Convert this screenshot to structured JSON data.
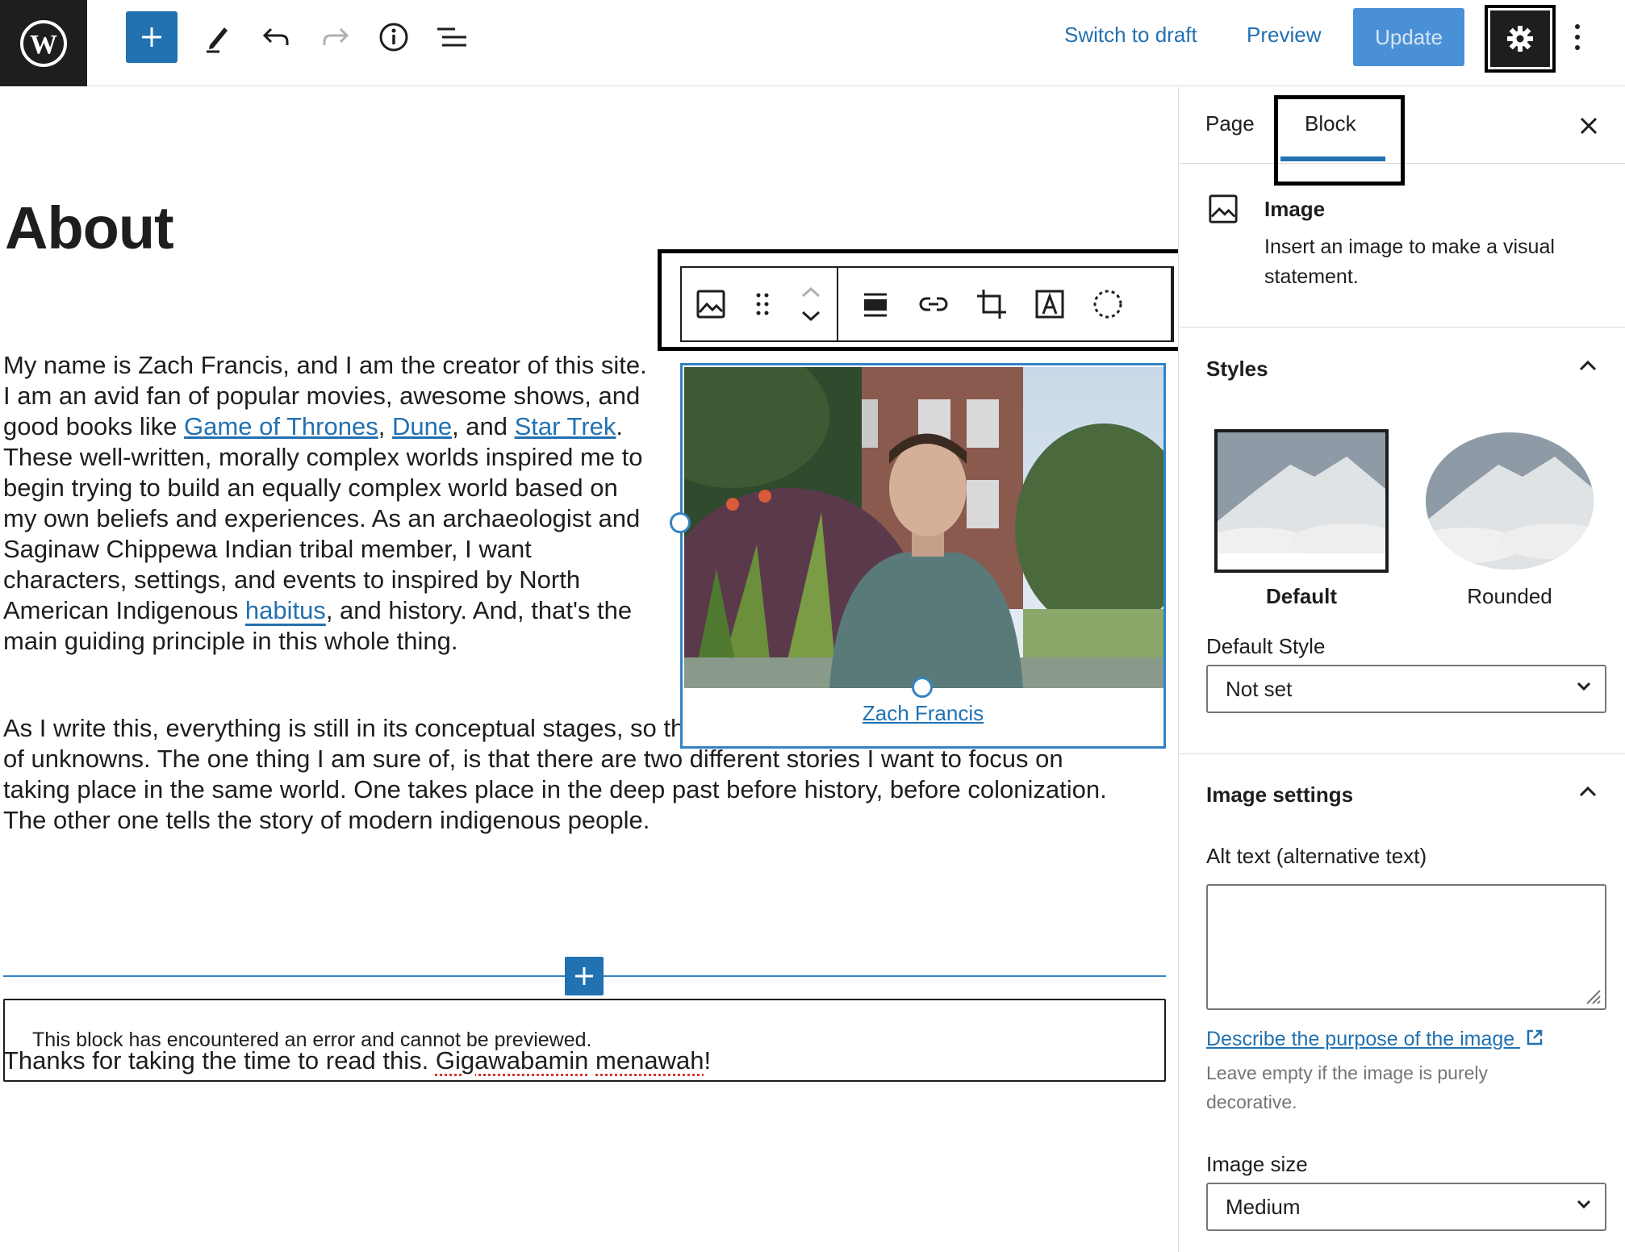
{
  "topbar": {
    "switch_to_draft": "Switch to draft",
    "preview": "Preview",
    "update": "Update",
    "icons": [
      "wordpress-logo",
      "plus-icon",
      "pencil-icon",
      "undo-icon",
      "redo-icon",
      "info-icon",
      "list-view-icon",
      "gear-icon",
      "more-vertical-icon"
    ]
  },
  "editor": {
    "title": "About",
    "paragraph1": {
      "t1": "My name is Zach Francis, and I am the creator of this site. I am an avid fan of popular movies, awesome shows, and good books like ",
      "link1": "Game of Thrones",
      "t2": ", ",
      "link2": "Dune",
      "t3": ", and ",
      "link3": "Star Trek",
      "t4": ". These well-written, morally complex worlds inspired me to begin trying to build an equally complex world based on my own beliefs and experiences. As an archaeologist and Saginaw Chippewa Indian tribal member, I want characters, settings, and events to  inspired by North American Indigenous ",
      "link4": "habitus",
      "t5": ", and history. And, that's the main guiding principle in this whole thing."
    },
    "paragraph2": "As I write this, everything is still in its conceptual stages, so there is a lot of world-building to do. A lot of unknowns. The one thing I am sure of, is that there are two different stories I want to focus on taking place in the same world.  One takes place in the deep past before history, before colonization. The other one tells the story of modern indigenous people.",
    "image_caption": "Zach Francis",
    "error_message": "This block has encountered an error and cannot be previewed.",
    "paragraph3": {
      "t1": "Thanks for taking the time to read this. ",
      "w1": "Gigawabamin",
      "t2": " ",
      "w2": "menawah",
      "t3": "!"
    }
  },
  "sidebar": {
    "tabs": [
      {
        "label": "Page"
      },
      {
        "label": "Block"
      }
    ],
    "active_tab": "Block",
    "block_card": {
      "title": "Image",
      "description": "Insert an image to make a visual statement."
    },
    "styles": {
      "title": "Styles",
      "options": [
        {
          "label": "Default"
        },
        {
          "label": "Rounded"
        }
      ],
      "default_style_label": "Default Style",
      "default_style_value": "Not set"
    },
    "image_settings": {
      "title": "Image settings",
      "alt_label": "Alt text (alternative text)",
      "alt_value": "",
      "describe_link": "Describe the purpose of the image",
      "help": "Leave empty if the image is purely decorative.",
      "size_label": "Image size",
      "size_value": "Medium"
    }
  },
  "colors": {
    "accent": "#2271b1",
    "dark": "#1e1e1e"
  }
}
